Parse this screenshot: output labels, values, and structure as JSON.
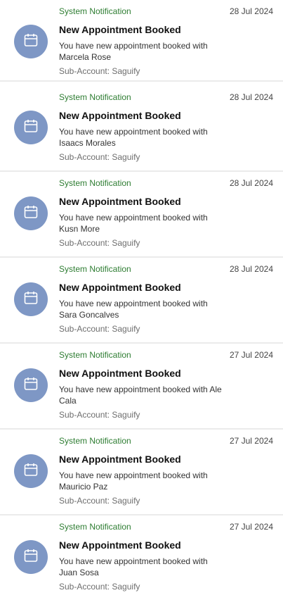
{
  "colors": {
    "notification_type": "#2e7d32",
    "avatar_bg": "#7e97c5",
    "avatar_icon": "#ffffff"
  },
  "notifications": [
    {
      "type": "System Notification",
      "date": "28 Jul 2024",
      "title": "New Appointment Booked",
      "message": "You have new appointment booked with Marcela Rose",
      "sub_account": "Sub-Account: Saguify",
      "icon": "calendar-icon"
    },
    {
      "type": "System Notification",
      "date": "28 Jul 2024",
      "title": "New Appointment Booked",
      "message": "You have new appointment booked with Isaacs Morales",
      "sub_account": "Sub-Account: Saguify",
      "icon": "calendar-icon"
    },
    {
      "type": "System Notification",
      "date": "28 Jul 2024",
      "title": "New Appointment Booked",
      "message": "You have new appointment booked with Kusn More",
      "sub_account": "Sub-Account: Saguify",
      "icon": "calendar-icon"
    },
    {
      "type": "System Notification",
      "date": "28 Jul 2024",
      "title": "New Appointment Booked",
      "message": "You have new appointment booked with Sara Goncalves",
      "sub_account": "Sub-Account: Saguify",
      "icon": "calendar-icon"
    },
    {
      "type": "System Notification",
      "date": "27 Jul 2024",
      "title": "New Appointment Booked",
      "message": "You have new appointment booked with Ale Cala",
      "sub_account": "Sub-Account: Saguify",
      "icon": "calendar-icon"
    },
    {
      "type": "System Notification",
      "date": "27 Jul 2024",
      "title": "New Appointment Booked",
      "message": "You have new appointment booked with Mauricio Paz",
      "sub_account": "Sub-Account: Saguify",
      "icon": "calendar-icon"
    },
    {
      "type": "System Notification",
      "date": "27 Jul 2024",
      "title": "New Appointment Booked",
      "message": "You have new appointment booked with Juan Sosa",
      "sub_account": "Sub-Account: Saguify",
      "icon": "calendar-icon"
    }
  ]
}
